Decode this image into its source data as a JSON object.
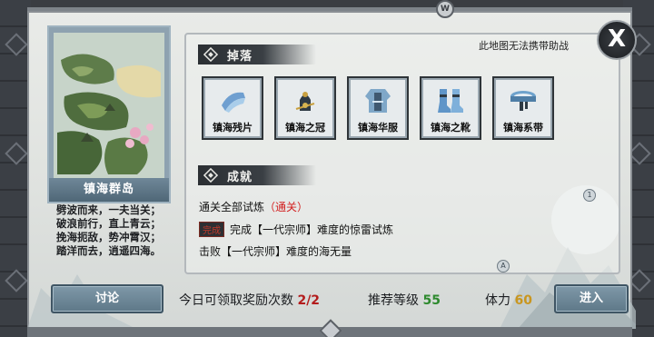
{
  "top_marker": "W",
  "map": {
    "name": "镇海群岛"
  },
  "poem": [
    "劈波而来，一夫当关；",
    "破浪前行，直上青云；",
    "挽海扼敌，势冲霄汉；",
    "踏洋而去，逍遥四海。"
  ],
  "discuss_label": "讨论",
  "map_note": "此地图无法携带助战",
  "drops": {
    "title": "掉落",
    "items": [
      {
        "name": "镇海残片",
        "icon": "cloth-scroll-icon"
      },
      {
        "name": "镇海之冠",
        "icon": "crown-icon"
      },
      {
        "name": "镇海华服",
        "icon": "armor-robe-icon"
      },
      {
        "name": "镇海之靴",
        "icon": "boots-icon"
      },
      {
        "name": "镇海系带",
        "icon": "belt-icon"
      }
    ]
  },
  "achievements": {
    "title": "成就",
    "line1_prefix": "通关全部试炼",
    "line1_status": "（通关）",
    "line2_stamp": "完成",
    "line2_text": "完成【一代宗师】难度的惊雷试炼",
    "line3_text": "击败【一代宗师】难度的海无量"
  },
  "bottom": {
    "reward_label": "今日可领取奖励次数",
    "reward_value": "2/2",
    "level_label": "推荐等级",
    "level_value": "55",
    "stamina_label": "体力",
    "stamina_value": "60",
    "enter_label": "进入"
  },
  "bubbles": [
    "1",
    "A"
  ],
  "close_symbol": "X"
}
